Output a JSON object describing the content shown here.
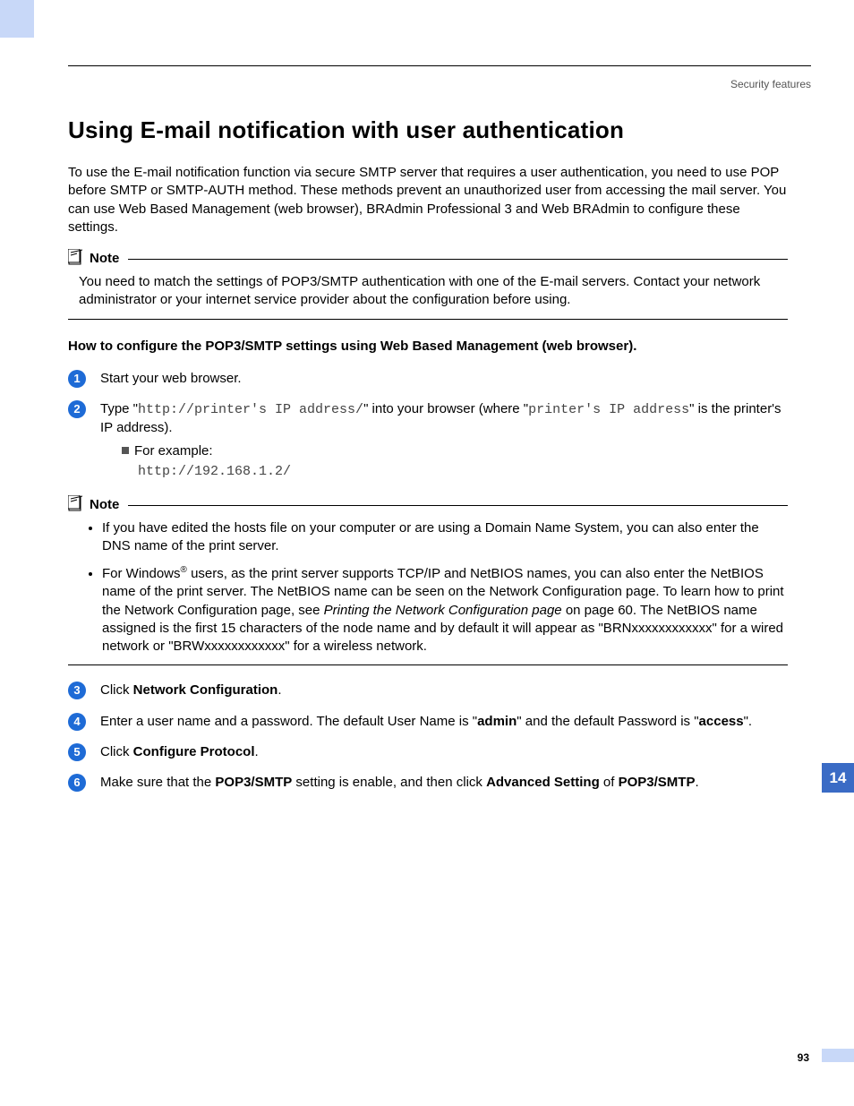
{
  "header": {
    "section": "Security features"
  },
  "title": "Using E-mail notification with user authentication",
  "intro": "To use the E-mail notification function via secure SMTP server that requires a user authentication, you need to use POP before SMTP or SMTP-AUTH method. These methods prevent an unauthorized user from accessing the mail server. You can use Web Based Management (web browser), BRAdmin Professional 3 and Web BRAdmin to configure these settings.",
  "note1": {
    "label": "Note",
    "text": "You need to match the settings of POP3/SMTP authentication with one of the E-mail servers. Contact your network administrator or your internet service provider about the configuration before using."
  },
  "subhead": "How to configure the POP3/SMTP settings using Web Based Management (web browser).",
  "steps": {
    "s1": "Start your web browser.",
    "s2a": "Type \"",
    "s2b": "http://printer's IP address/",
    "s2c": "\" into your browser (where \"",
    "s2d": "printer's IP address",
    "s2e": "\" is the printer's IP address).",
    "s2_example_label": "For example:",
    "s2_example_url": "http://192.168.1.2/",
    "s3a": "Click ",
    "s3b": "Network Configuration",
    "s3c": ".",
    "s4a": "Enter a user name and a password. The default User Name is \"",
    "s4b": "admin",
    "s4c": "\" and the default Password is \"",
    "s4d": "access",
    "s4e": "\".",
    "s5a": "Click ",
    "s5b": "Configure Protocol",
    "s5c": ".",
    "s6a": "Make sure that the ",
    "s6b": "POP3/SMTP",
    "s6c": " setting is enable, and then click ",
    "s6d": "Advanced Setting",
    "s6e": " of ",
    "s6f": "POP3/SMTP",
    "s6g": "."
  },
  "note2": {
    "label": "Note",
    "b1": "If you have edited the hosts file on your computer or are using a Domain Name System, you can also enter the DNS name of the print server.",
    "b2a": "For Windows",
    "b2b": " users, as the print server supports TCP/IP and NetBIOS names, you can also enter the NetBIOS name of the print server. The NetBIOS name can be seen on the Network Configuration page. To learn how to print the Network Configuration page, see ",
    "b2c": "Printing the Network Configuration page",
    "b2d": " on page 60. The NetBIOS name assigned is the first 15 characters of the node name and by default it will appear as \"BRNxxxxxxxxxxxx\" for a wired network or \"BRWxxxxxxxxxxxx\" for a wireless network."
  },
  "chapter": "14",
  "page": "93"
}
